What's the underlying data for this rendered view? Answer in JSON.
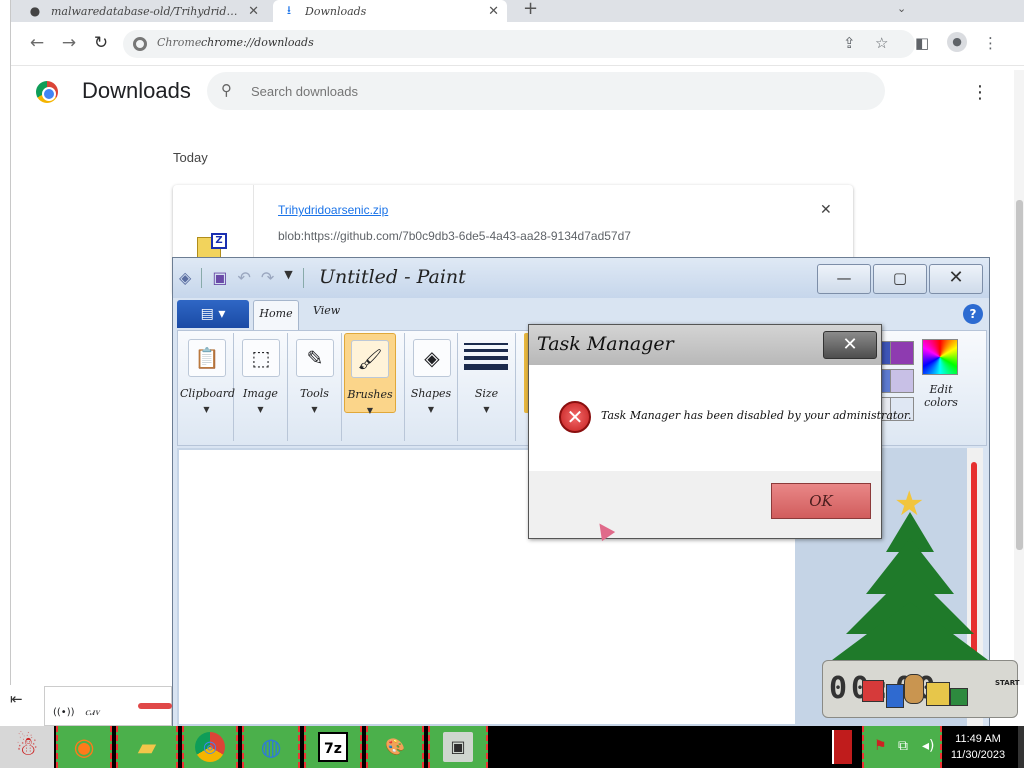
{
  "chrome": {
    "tabs": [
      {
        "title": "malwaredatabase-old/Trihydridoarsenic.zip",
        "icon": "github-icon",
        "close": "✕"
      },
      {
        "title": "Downloads",
        "icon": "download-icon",
        "close": "✕"
      }
    ],
    "new_tab": "+",
    "tab_search": "⌄",
    "omnibox": {
      "site_label": "Chrome",
      "url": "chrome://downloads"
    },
    "nav": {
      "back": "←",
      "forward": "→",
      "reload": "↻"
    },
    "actions": {
      "share": "⇪",
      "bookmark": "☆",
      "sidepanel": "◧",
      "profile": "●",
      "menu": "⋮"
    }
  },
  "downloads": {
    "title": "Downloads",
    "search_placeholder": "Search downloads",
    "menu": "⋮",
    "section": "Today",
    "item": {
      "filename": "Trihydridoarsenic.zip",
      "url": "blob:https://github.com/7b0c9db3-6de5-4a43-aa28-9134d7ad57d7",
      "remove": "✕",
      "file_icon_letter": "Z"
    }
  },
  "paint": {
    "title": "Untitled - Paint",
    "buttons": {
      "minimize": "—",
      "maximize": "▢",
      "close": "✕"
    },
    "file_menu": "▤ ▾",
    "tabs": [
      "Home",
      "View"
    ],
    "help": "?",
    "groups": [
      {
        "label": "Clipboard",
        "icon": "clipboard-icon",
        "glyph": "📋"
      },
      {
        "label": "Image",
        "icon": "select-icon",
        "glyph": "⬚"
      },
      {
        "label": "Tools",
        "icon": "tools-icon",
        "glyph": "✎"
      },
      {
        "label": "Brushes",
        "icon": "brush-icon",
        "glyph": "🖌"
      },
      {
        "label": "Shapes",
        "icon": "shapes-icon",
        "glyph": "◈"
      },
      {
        "label": "Size",
        "icon": "size-icon",
        "glyph": ""
      }
    ],
    "caret": "▼",
    "edit_colors": "Edit colors",
    "colors": [
      "#8e3bb0",
      "#3d55b8",
      "#c8c0e6",
      "#dfe7f3",
      "#5e7bd0",
      "#e8eaf0"
    ]
  },
  "task_manager": {
    "title": "Task Manager",
    "close": "✕",
    "message": "Task Manager has been disabled by your administrator.",
    "error_icon": "✕",
    "ok": "OK"
  },
  "xmas_widget": {
    "star": "★",
    "clock_display": "00:00",
    "start": "START"
  },
  "taskbar": {
    "start_icon": "☃",
    "apps": [
      {
        "name": "firefox",
        "glyph": "◉",
        "color": "#ff7a1a"
      },
      {
        "name": "file-explorer",
        "glyph": "▰",
        "color": "#f2c64a"
      },
      {
        "name": "chrome",
        "glyph": "◎",
        "color": "#ffffff"
      },
      {
        "name": "msn-messenger",
        "glyph": "◍",
        "color": "#2f7ad6"
      },
      {
        "name": "7zip",
        "glyph": "7z",
        "color": "#000000"
      },
      {
        "name": "paint",
        "glyph": "🎨",
        "color": "#ffffff"
      },
      {
        "name": "task-manager",
        "glyph": "▣",
        "color": "#2d2d2d"
      }
    ],
    "time": "11:49 AM",
    "date": "11/30/2023"
  },
  "fragments": {
    "collapse": "⇤",
    "wifi": "((•))",
    "speaker_text": "ꮯꮧꮩ"
  }
}
